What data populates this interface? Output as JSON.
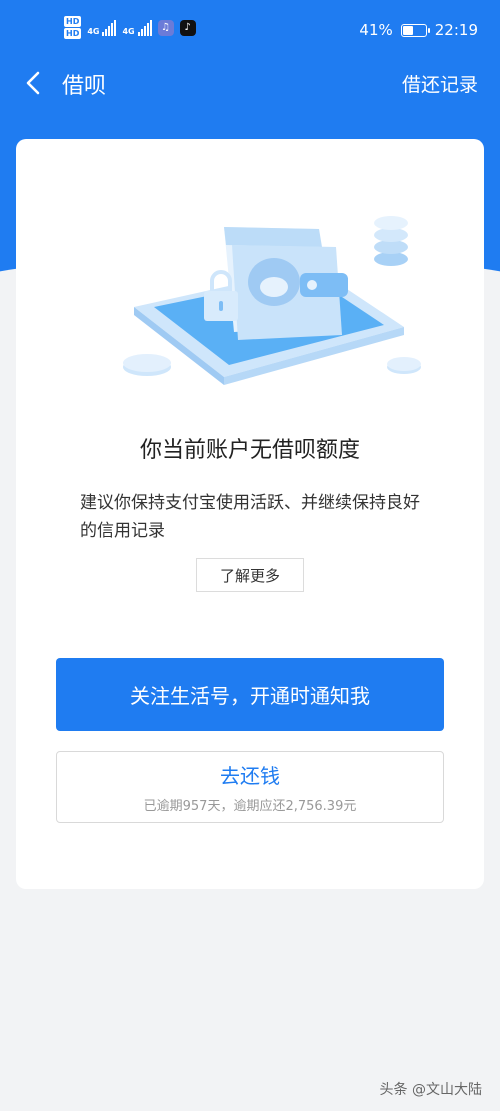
{
  "status_bar": {
    "hd_labels": [
      "HD",
      "HD"
    ],
    "signal_labels": [
      "4G",
      "4G"
    ],
    "battery_percent": "41%",
    "battery_level": 0.41,
    "time": "22:19",
    "app_icons": [
      "music-app-icon",
      "tiktok-icon"
    ]
  },
  "nav": {
    "title": "借呗",
    "right_link": "借还记录",
    "back_icon": "chevron-left-icon"
  },
  "card": {
    "headline": "你当前账户无借呗额度",
    "description": "建议你保持支付宝使用活跃、并继续保持良好的信用记录",
    "learn_more": "了解更多",
    "primary_button": "关注生活号，开通时通知我",
    "repay_button": {
      "label": "去还钱",
      "subtext": "已逾期957天，逾期应还2,756.39元"
    }
  },
  "watermark": "头条 @文山大陆",
  "colors": {
    "accent": "#1f7cf1",
    "background": "#f2f3f5",
    "card": "#ffffff"
  }
}
